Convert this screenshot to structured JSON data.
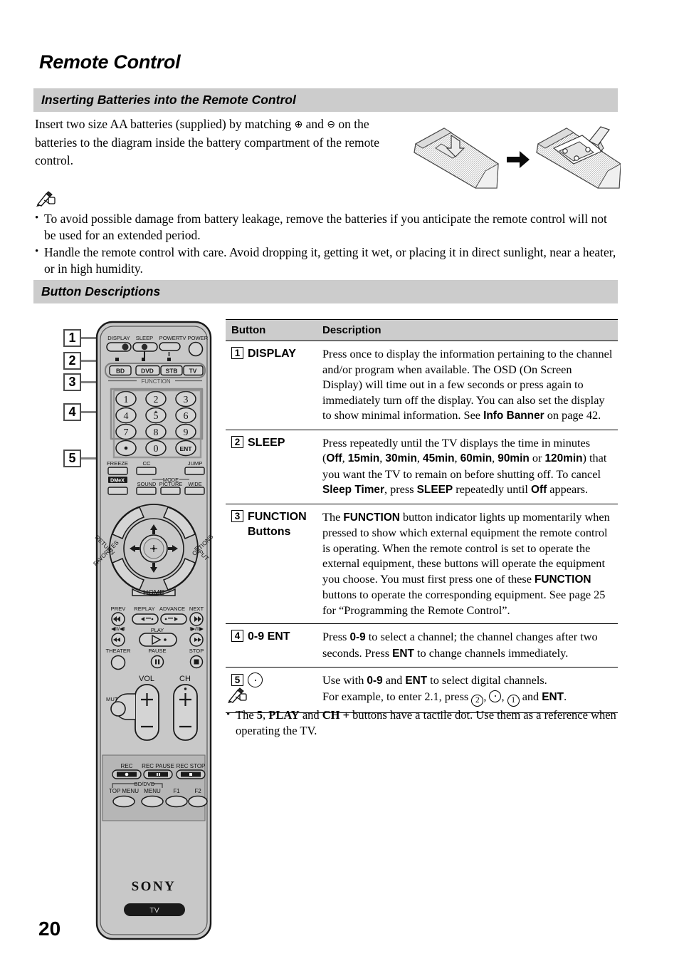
{
  "page": {
    "title": "Remote Control",
    "number": "20"
  },
  "sections": {
    "batteries": {
      "heading": "Inserting Batteries into the Remote Control",
      "intro_1": "Insert two size AA batteries (supplied) by matching ",
      "plus_symbol": "⊕",
      "intro_2": " and ",
      "minus_symbol": "⊖",
      "intro_3": " on the batteries to the diagram inside the battery compartment of the remote control.",
      "figure_name": "battery-insertion-diagram"
    },
    "buttons": {
      "heading": "Button Descriptions"
    }
  },
  "notes_top": {
    "icon": "note-pencil-icon",
    "items": [
      "To avoid possible damage from battery leakage, remove the batteries if you anticipate the remote control will not be used for an extended period.",
      "Handle the remote control with care. Avoid dropping it, getting it wet, or placing it in direct sunlight, near a heater, or in high humidity."
    ]
  },
  "notes_bottom": {
    "icon": "note-pencil-icon",
    "items_html": [
      "The <b>5</b>, <b>PLAY</b> and <b>CH +</b> buttons have a tactile dot. Use them as a reference when operating the TV."
    ]
  },
  "table": {
    "headers": [
      "Button",
      "Description"
    ],
    "rows": [
      {
        "num": "1",
        "button": "DISPLAY",
        "description_html": "Press once to display the information pertaining to the channel and/or program when available. The OSD (On Screen Display) will time out in a few seconds or press again to immediately turn off the display. You can also set the display to show minimal information. See <b>Info Banner</b> on page 42."
      },
      {
        "num": "2",
        "button": "SLEEP",
        "description_html": "Press repeatedly until the TV displays the time in minutes (<b>Off</b>, <b>15min</b>, <b>30min</b>, <b>45min</b>, <b>60min</b>, <b>90min</b> or <b>120min</b>) that you want the TV to remain on before shutting off. To cancel <b>Sleep Timer</b>, press <b>SLEEP</b> repeatedly until <b>Off</b> appears."
      },
      {
        "num": "3",
        "button": "FUNCTION Buttons",
        "description_html": "The <b>FUNCTION</b> button indicator lights up momentarily when pressed to show which external equipment the remote control is operating. When the remote control is set to operate the external equipment, these buttons will operate the equipment you choose. You must first press one of these <b>FUNCTION</b> buttons to operate the corresponding equipment. See page 25 for “Programming the Remote Control”."
      },
      {
        "num": "4",
        "button": "0-9 ENT",
        "description_html": "Press <b>0-9</b> to select a channel; the channel changes after two seconds. Press <b>ENT</b> to change channels immediately."
      },
      {
        "num": "5",
        "button": "",
        "button_icon": "dot-button-icon",
        "description_html": "Use with <b>0-9</b> and <b>ENT</b> to select digital channels.<br>For example, to enter 2.1, press <span class=\"minibtn\">2</span>, <span class=\"minibtn minidot\"></span>, <span class=\"minibtn\">1</span> and <b>ENT</b>."
      }
    ]
  },
  "callouts": [
    {
      "label": "1",
      "target": "DISPLAY"
    },
    {
      "label": "2",
      "target": "SLEEP"
    },
    {
      "label": "3",
      "target": "FUNCTION"
    },
    {
      "label": "4",
      "target": "0-9 ENT"
    },
    {
      "label": "5",
      "target": "dot"
    }
  ],
  "remote": {
    "brand": "SONY",
    "mode_badge": "TV",
    "top_row": [
      "DISPLAY",
      "SLEEP",
      "POWER",
      "TV POWER"
    ],
    "function_label": "FUNCTION",
    "function_buttons": [
      "BD",
      "DVD",
      "STB",
      "TV"
    ],
    "keypad": [
      "1",
      "2",
      "3",
      "4",
      "5",
      "6",
      "7",
      "8",
      "9",
      "·",
      "0",
      "ENT"
    ],
    "feature_row_1": [
      "FREEZE",
      "CC",
      "JUMP"
    ],
    "feature_row_2_labels": [
      "DMeX",
      "SOUND",
      "PICTURE",
      "WIDE"
    ],
    "mode_label": "MODE",
    "ring": {
      "top_left": "FAVORITES",
      "top_right": "INPUT",
      "bottom_left": "RETURN",
      "bottom_right": "OPTIONS",
      "bottom": "HOME"
    },
    "transport_row_1": [
      "PREV",
      "REPLAY",
      "ADVANCE",
      "NEXT"
    ],
    "transport_row_2": [
      "◀II/◀I",
      "PLAY",
      "I▶/II▶"
    ],
    "transport_row_3": [
      "THEATER",
      "PAUSE",
      "STOP"
    ],
    "volume_label": "VOL",
    "channel_label": "CH",
    "muting_label": "MUTING",
    "rec_row": [
      "REC",
      "REC PAUSE",
      "REC STOP"
    ],
    "bd_dvd_label": "BD/DVD",
    "menu_row": [
      "TOP MENU",
      "MENU",
      "F1",
      "F2"
    ]
  },
  "colors": {
    "section_bar": "#cccccc",
    "remote_body": "#c8c8c8",
    "remote_panel": "#bdbdbd",
    "button_fill": "#d4d4d4",
    "callout_border": "#4d4d4d",
    "callout_line": "#808080",
    "text": "#000000"
  }
}
